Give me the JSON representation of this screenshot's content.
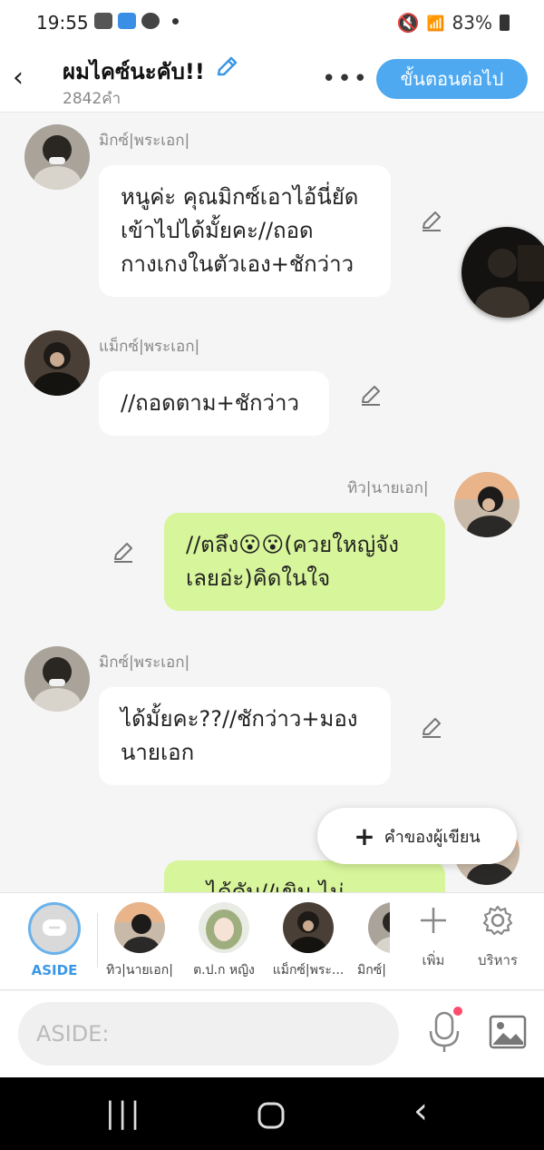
{
  "status_bar": {
    "time": "19:55",
    "battery": "83%"
  },
  "header": {
    "title": "ผมไคซ์นะคับ!!",
    "word_count": "2842คำ",
    "next_button": "ขั้นตอนต่อไป"
  },
  "messages": [
    {
      "speaker": "มิกซ์|พระเอก|",
      "side": "left",
      "text": "หนูค่ะ คุณมิกซ์เอาไอ้นี่ยัดเข้าไปได้มั้ยคะ//ถอดกางเกงในตัวเอง+ชักว่าว"
    },
    {
      "speaker": "แม็กซ์|พระเอก|",
      "side": "left",
      "text": "//ถอดตาม+ชักว่าว"
    },
    {
      "speaker": "ทิว|นายเอก|",
      "side": "right",
      "text": "//ตลึง😮😮(ควยใหญ่จังเลยอ่ะ)คิดในใจ"
    },
    {
      "speaker": "มิกซ์|พระเอก|",
      "side": "left",
      "text": "ได้มั้ยคะ??//ชักว่าว+มองนายเอก"
    },
    {
      "speaker": "",
      "side": "right",
      "text": "...ได้คับ//เขิน ไม่..."
    }
  ],
  "author_note_button": "คำของผู้เขียน",
  "characters": {
    "aside_label": "ASIDE",
    "list": [
      {
        "label": "ทิว|นายเอก|"
      },
      {
        "label": "ต.ป.ก หญิง"
      },
      {
        "label": "แม็กซ์|พระ..."
      },
      {
        "label": "มิกซ์|"
      }
    ],
    "add_label": "เพิ่ม",
    "manage_label": "บริหาร"
  },
  "input": {
    "placeholder": "ASIDE:"
  },
  "colors": {
    "accent": "#4ea9f0",
    "green_bubble": "#d7f59a",
    "white_bubble": "#ffffff"
  }
}
